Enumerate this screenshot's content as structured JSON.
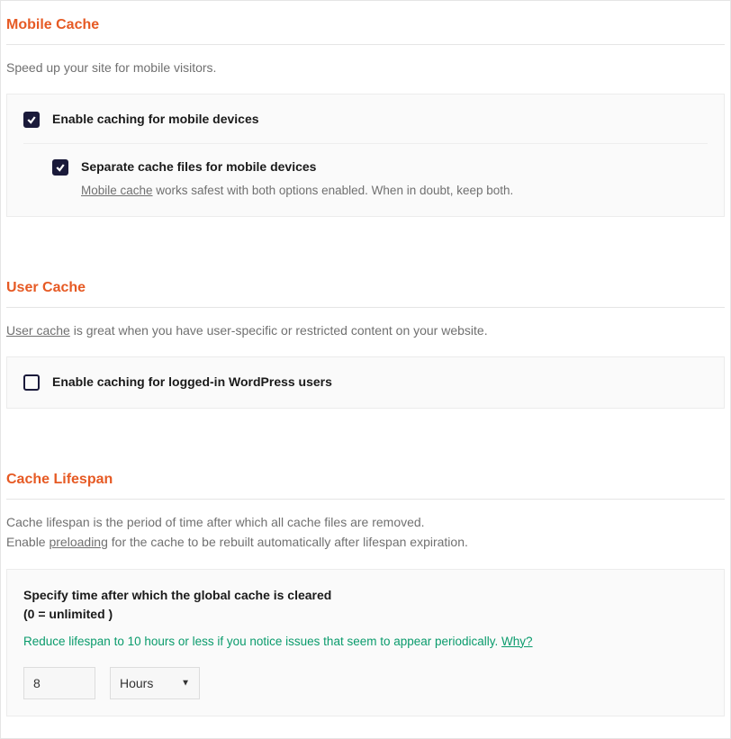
{
  "mobile_cache": {
    "title": "Mobile Cache",
    "desc": "Speed up your site for mobile visitors.",
    "option1": {
      "label": "Enable caching for mobile devices",
      "checked": true
    },
    "option2": {
      "label": "Separate cache files for mobile devices",
      "checked": true,
      "help_link": "Mobile cache",
      "help_rest": " works safest with both options enabled. When in doubt, keep both."
    }
  },
  "user_cache": {
    "title": "User Cache",
    "desc_link": "User cache",
    "desc_rest": " is great when you have user-specific or restricted content on your website.",
    "option1": {
      "label": "Enable caching for logged-in WordPress users",
      "checked": false
    }
  },
  "cache_lifespan": {
    "title": "Cache Lifespan",
    "desc_line1": "Cache lifespan is the period of time after which all cache files are removed.",
    "desc_line2_pre": "Enable ",
    "desc_line2_link": "preloading",
    "desc_line2_post": " for the cache to be rebuilt automatically after lifespan expiration.",
    "heading_line1": "Specify time after which the global cache is cleared",
    "heading_line2": "(0 = unlimited )",
    "hint_text": "Reduce lifespan to 10 hours or less if you notice issues that seem to appear periodically. ",
    "hint_link": "Why?",
    "value": "8",
    "unit": "Hours"
  }
}
